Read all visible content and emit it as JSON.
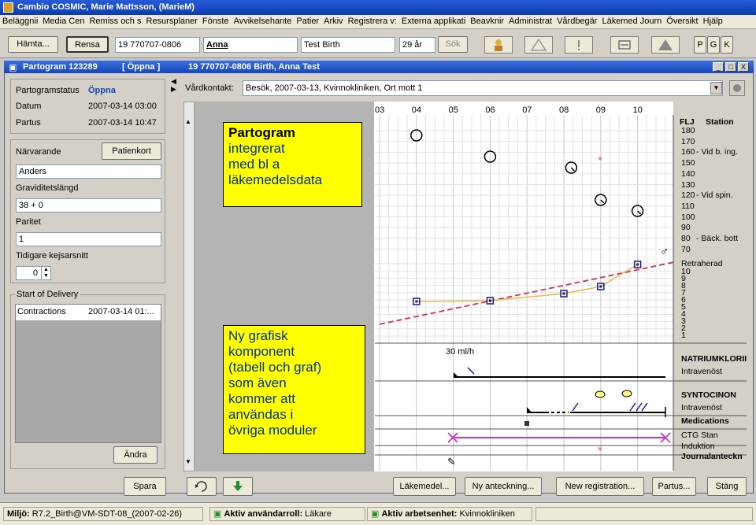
{
  "app": {
    "title": "Cambio COSMIC, Marie Mattsson, (MarieM)",
    "window_controls": [
      "_",
      "□",
      "X"
    ]
  },
  "menu": [
    "Beläggnii",
    "Media Cen",
    "Remiss och s",
    "Resursplaner",
    "Fönste",
    "Avvikelsehante",
    "Patier",
    "Arkiv",
    "Registrera v:",
    "Externa applikati",
    "Beavknir",
    "Administrat",
    "Vårdbegär",
    "Läkemed Journ",
    "Översikt",
    "Hjälp"
  ],
  "toolbar": {
    "hamta_label": "Hämta...",
    "rensa_label": "Rensa",
    "personnummer": "19 770707-0806",
    "first_name": "Anna",
    "full_name": "Test Birth",
    "age": "29 år",
    "sok_label": "Sök",
    "letters": [
      "P",
      "G",
      "K"
    ]
  },
  "partogram_window": {
    "title": "Partogram 123289",
    "state": "[ Öppna ]",
    "patient": "19 770707-0806 Birth, Anna Test"
  },
  "left_panel": {
    "status_label": "Partogramstatus",
    "status_value": "Öppna",
    "datum_label": "Datum",
    "datum_value": "2007-03-14 03:00",
    "partus_label": "Partus",
    "partus_value": "2007-03-14 10:47",
    "narvarande_label": "Närvarande",
    "patientkort_label": "Patienkort",
    "narvarande_value": "Anders",
    "gravid_label": "Graviditetslängd",
    "gravid_value": "38 + 0",
    "paritet_label": "Paritet",
    "paritet_value": "1",
    "kejsar_label": "Tidigare kejsarsnitt",
    "kejsar_value": "0",
    "delivery_group": "Start of Delivery",
    "contractions_label": "Contractions",
    "contractions_value": "2007-03-14 01:...",
    "andra_label": "Ändra",
    "spara_label": "Spara"
  },
  "vardkontakt": {
    "label": "Vårdkontakt:",
    "value": "Besök, 2007-03-13, Kvinnokliniken, Ort mott 1"
  },
  "chart": {
    "hours": [
      "03",
      "04",
      "05",
      "06",
      "07",
      "08",
      "09",
      "10"
    ],
    "right_labels_top": [
      "FLJ",
      "Station"
    ],
    "fhr_ticks": [
      "180",
      "170",
      "160",
      "150",
      "140",
      "130",
      "120",
      "110",
      "100",
      "90",
      "80",
      "70"
    ],
    "fhr_notes": {
      "160": "Vid b. ing.",
      "120": "Vid spin.",
      "80": "Bäck. bott"
    },
    "cervix_label": "Retraherad",
    "cervix_ticks": [
      "10",
      "9",
      "8",
      "7",
      "6",
      "5",
      "4",
      "3",
      "2",
      "1"
    ],
    "rate_label": "30 ml/h",
    "row_labels": [
      "NATRIUMKLORII",
      "Intravenöst",
      "SYNTOCINON",
      "Intravenöst",
      "Medications",
      "CTG Stan",
      "Induktion",
      "Journalanteckn"
    ]
  },
  "callouts": {
    "top_title": "Partogram",
    "top_lines": [
      "integrerat",
      "med bl a",
      "läkemedelsdata"
    ],
    "bottom_lines": [
      "Ny grafisk",
      "komponent",
      "(tabell och graf)",
      "som även",
      "kommer att",
      "användas i",
      "övriga moduler"
    ]
  },
  "bottom_buttons": {
    "lakemedel": "Läkemedel...",
    "ny_anteckning": "Ny anteckning...",
    "new_registration": "New registration...",
    "partus": "Partus...",
    "stang": "Stäng"
  },
  "statusbar": {
    "miljo_label": "Miljö:",
    "miljo_value": "R7.2_Birth@VM-SDT-08_(2007-02-26)",
    "roll_label": "Aktiv användarroll:",
    "roll_value": "Läkare",
    "enhet_label": "Aktiv arbetsenhet:",
    "enhet_value": "Kvinnokliniken"
  },
  "colors": {
    "title_blue": "#1746b8",
    "callout_yellow": "#ffff00",
    "callout_text": "#003399",
    "alert_line": "#d03060",
    "ctg_magenta": "#cc33cc",
    "marker_blue": "#1a1a8c"
  }
}
